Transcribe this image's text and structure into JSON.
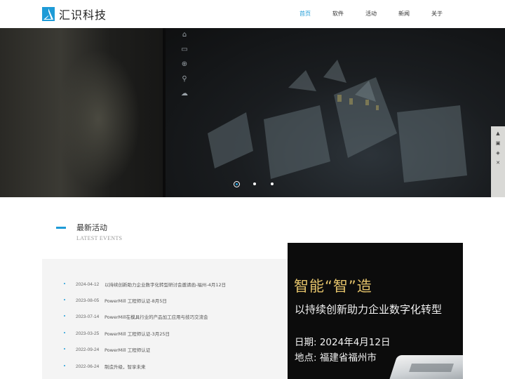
{
  "brand": {
    "name": "汇识科技",
    "accent_color": "#1e9bd7"
  },
  "nav": {
    "items": [
      {
        "label": "首页",
        "active": true
      },
      {
        "label": "软件",
        "active": false
      },
      {
        "label": "活动",
        "active": false
      },
      {
        "label": "新闻",
        "active": false
      },
      {
        "label": "关于",
        "active": false
      }
    ]
  },
  "hero": {
    "slide_count": 3,
    "active_slide": 1,
    "sidebar_icons": [
      "home-icon",
      "monitor-icon",
      "plus-circle-icon",
      "search-icon",
      "cloud-icon"
    ]
  },
  "events": {
    "title": "最新活动",
    "subtitle": "LATEST EVENTS",
    "items": [
      {
        "date": "2024-04-12",
        "title": "以持续创新助力企业数字化转型研讨会邀请函-福州-4月12日"
      },
      {
        "date": "2023-08-05",
        "title": "PowerMill 工程师认证-8月5日"
      },
      {
        "date": "2023-07-14",
        "title": "PowerMill在模具行业的产品加工应用与技巧交流会"
      },
      {
        "date": "2023-03-25",
        "title": "PowerMill 工程师认证-3月25日"
      },
      {
        "date": "2022-09-24",
        "title": "PowerMill 工程师认证"
      },
      {
        "date": "2022-06-24",
        "title": "制造升级，智享未来"
      }
    ]
  },
  "poster": {
    "headline": "智能“智”造",
    "subheadline": "以持续创新助力企业数字化转型",
    "date_line": "日期: 2024年4月12日",
    "place_line": "地点: 福建省福州市",
    "headline_color": "#e3c26a"
  }
}
